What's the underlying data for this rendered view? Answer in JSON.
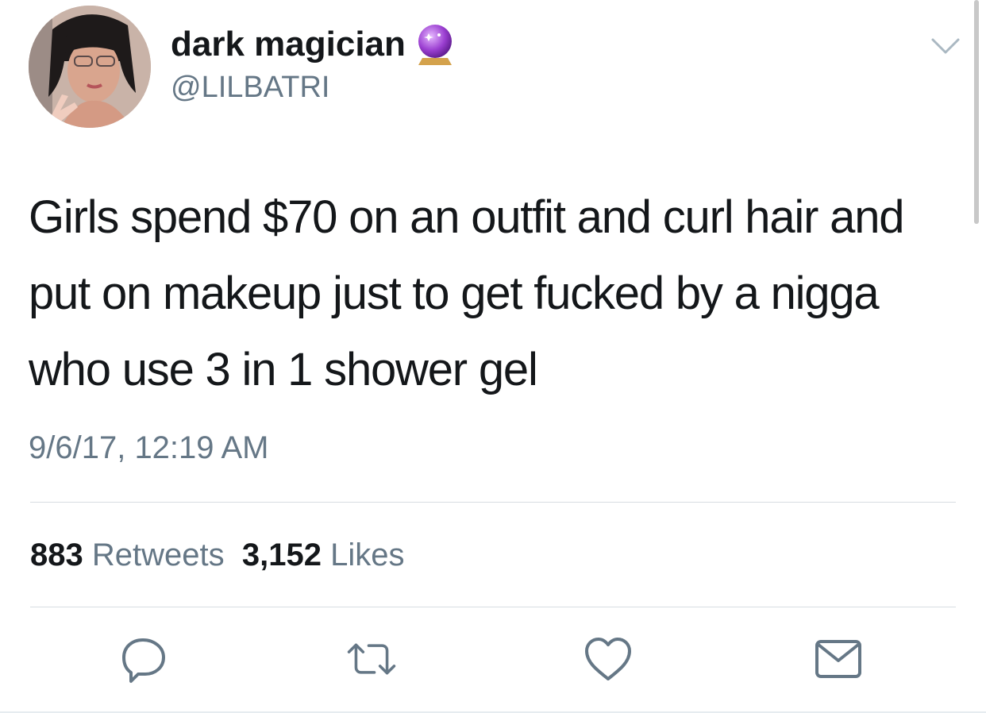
{
  "tweet": {
    "author": {
      "display_name": "dark magician",
      "handle": "@LILBATRI",
      "name_emoji": "crystal-ball-icon",
      "avatar": "avatar"
    },
    "text": "Girls spend $70 on an outfit and curl hair and put on makeup just to get fucked by a nigga who use 3 in 1 shower gel",
    "timestamp": "9/6/17, 12:19 AM",
    "stats": {
      "retweets_count": "883",
      "retweets_label": "Retweets",
      "likes_count": "3,152",
      "likes_label": "Likes"
    },
    "actions": [
      "reply-icon",
      "retweet-icon",
      "like-icon",
      "direct-message-icon"
    ]
  },
  "colors": {
    "primary_text": "#14171a",
    "secondary_text": "#657786",
    "divider": "#d7dde2",
    "icon": "#657786"
  }
}
